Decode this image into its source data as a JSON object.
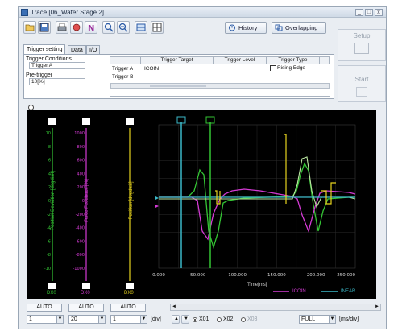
{
  "window": {
    "title": "Trace [06_Wafer Stage 2]"
  },
  "toolbar": {
    "history_label": "History",
    "overlapping_label": "Overlapping",
    "setup_label": "Setup",
    "start_label": "Start"
  },
  "tabs": [
    {
      "label": "Trigger setting"
    },
    {
      "label": "Data"
    },
    {
      "label": "I/O"
    }
  ],
  "trigger": {
    "conditions_label": "Trigger Conditions",
    "conditions_value": "Trigger A",
    "pretrigger_label": "Pre-trigger",
    "pretrigger_value": "10[%]",
    "columns": [
      "Trigger Target",
      "Trigger Level",
      "Trigger Type"
    ],
    "rows": [
      {
        "name": "Trigger A",
        "target": "ICOIN",
        "level": "",
        "type": "Rising Edge"
      },
      {
        "name": "Trigger B",
        "target": "",
        "level": "",
        "type": ""
      }
    ]
  },
  "scope": {
    "axes": [
      {
        "label": "Position Deviation [degdisit]",
        "color": "#34c534",
        "bottom": "DX0"
      },
      {
        "label": "Force Feedback [%]",
        "color": "#d43ad4",
        "bottom": "DX0"
      },
      {
        "label": "Position [degdisit]",
        "color": "#e6d31e",
        "bottom": "DX0"
      }
    ],
    "green_ticks": [
      "10",
      "8",
      "6",
      "4",
      "2",
      "0",
      "-2",
      "-4",
      "-6",
      "-8",
      "-10"
    ],
    "magenta_ticks": [
      "1000",
      "800",
      "600",
      "400",
      "200",
      "0",
      "-200",
      "-400",
      "-600",
      "-800",
      "-1000"
    ],
    "x_ticks": [
      "0.000",
      "50.000",
      "100.000",
      "150.000",
      "200.000",
      "250.000"
    ],
    "x_label": "Time[ms]",
    "legend": [
      {
        "name": "ICOIN",
        "color": "#d43ad4"
      },
      {
        "name": "INEAR",
        "color": "#3bb8c7"
      }
    ]
  },
  "bottom": {
    "auto_labels": [
      "AUTO",
      "AUTO",
      "AUTO"
    ],
    "div_values": [
      "1",
      "20",
      "1"
    ],
    "div_unit": "[div]",
    "cursor_labels": [
      "X01",
      "X02",
      "X03"
    ],
    "mode_value": "FULL",
    "time_unit": "[ms/div]"
  },
  "colors": {
    "green": "#34c534",
    "magenta": "#d43ad4",
    "yellow": "#e6d31e",
    "cyan": "#3bb8c7",
    "lightgreen": "#b9e6a0"
  }
}
